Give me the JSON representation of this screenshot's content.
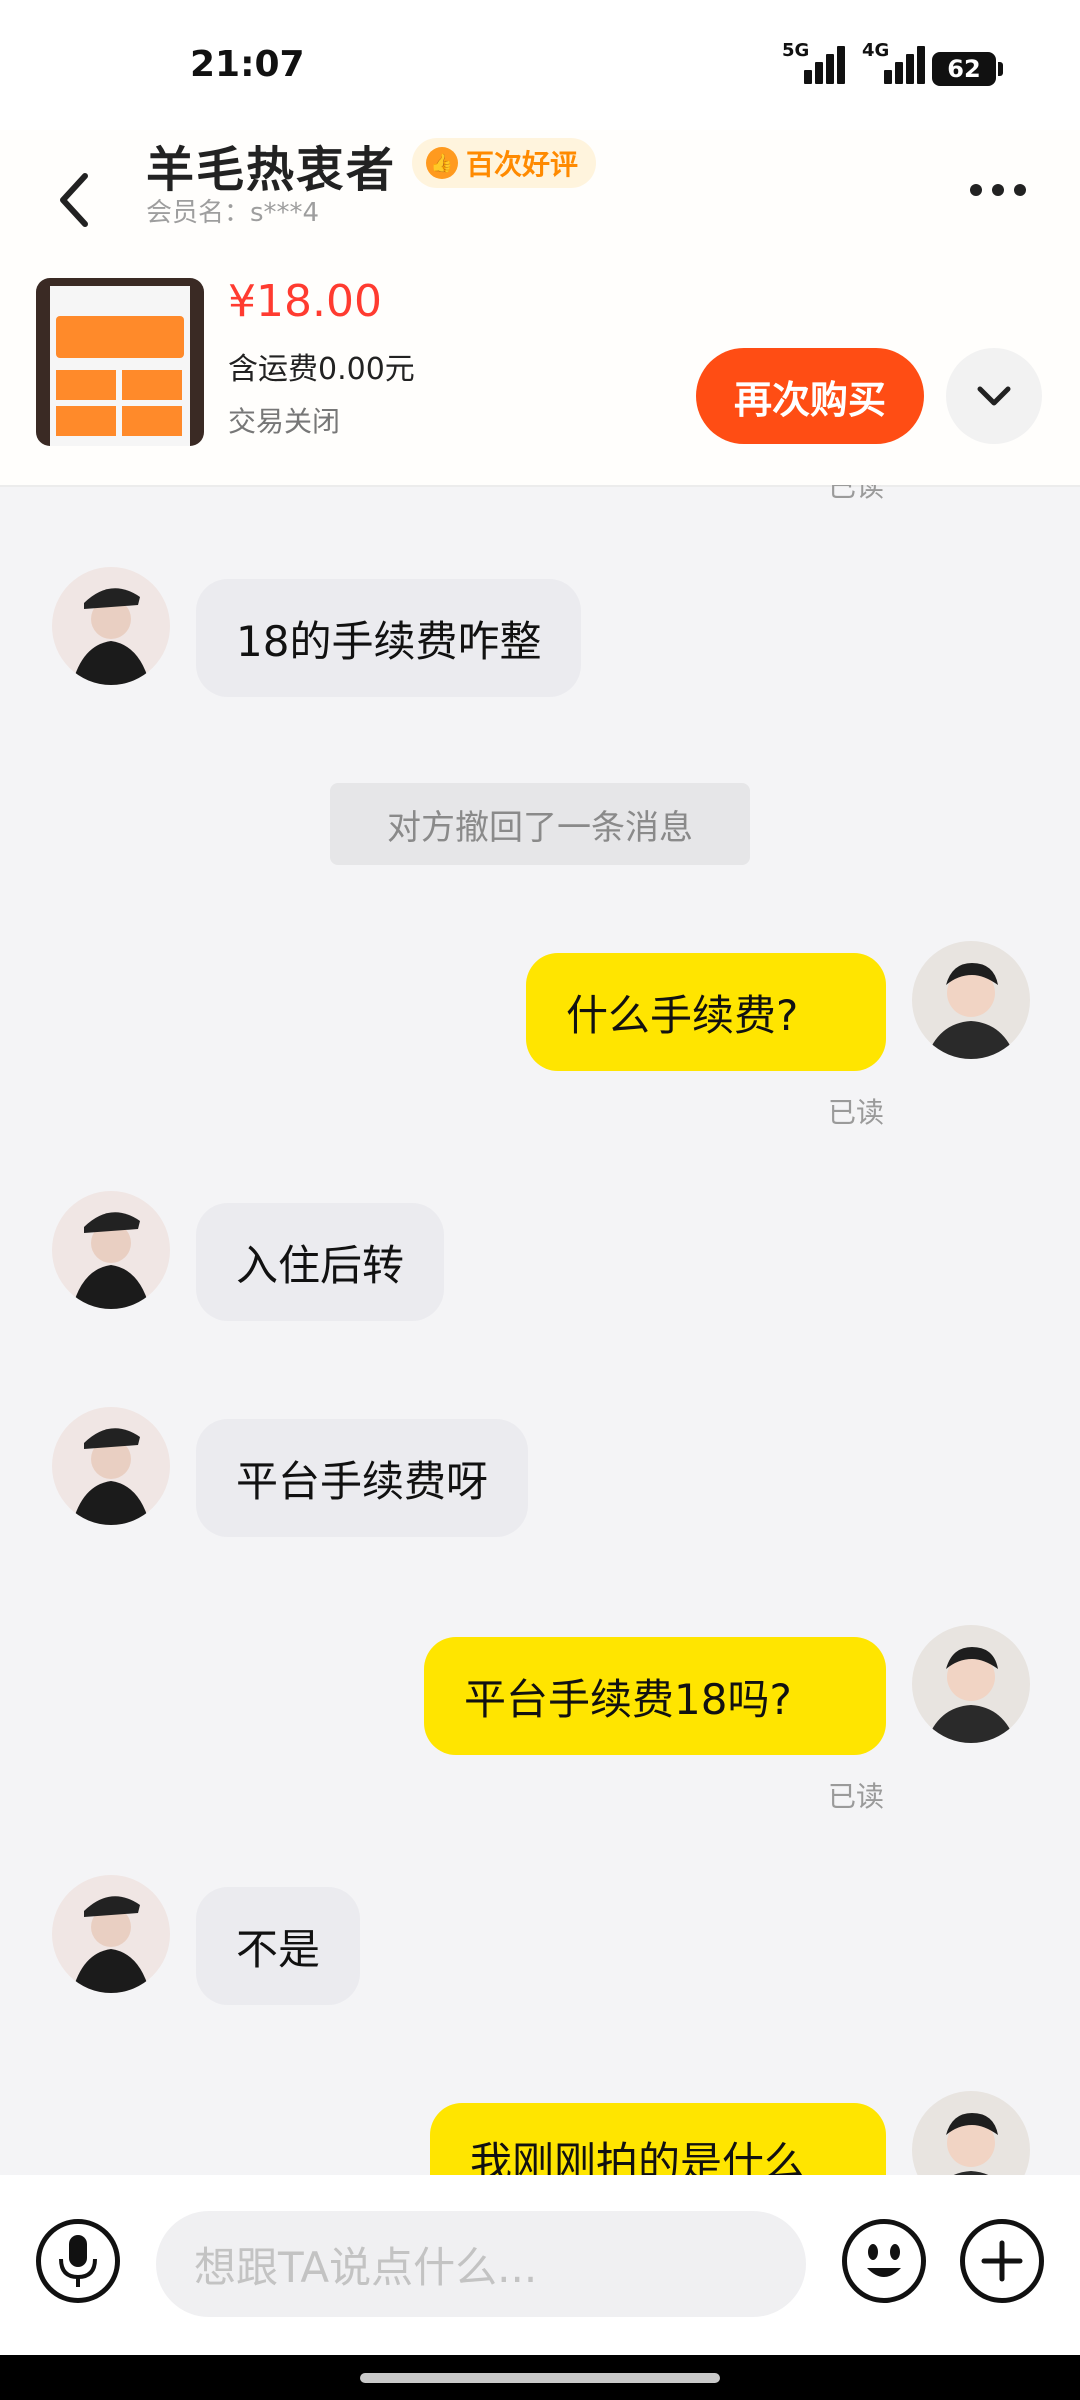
{
  "status_bar": {
    "time": "21:07",
    "network1": "5G",
    "network2": "4G",
    "battery": "62"
  },
  "header": {
    "title": "羊毛热衷者",
    "badge": "百次好评",
    "member": "会员名：s***4",
    "product": {
      "price": "¥18.00",
      "shipping": "含运费0.00元",
      "status": "交易关闭"
    },
    "buy_again": "再次购买"
  },
  "messages": {
    "top_read": "已读",
    "m1": "18的手续费咋整",
    "recall": "对方撤回了一条消息",
    "m2": "什么手续费?",
    "m2_read": "已读",
    "m3": "入住后转",
    "m4": "平台手续费呀",
    "m5": "平台手续费18吗?",
    "m5_read": "已读",
    "m6": "不是",
    "m7": "我刚刚拍的是什么"
  },
  "input": {
    "placeholder": "想跟TA说点什么..."
  },
  "colors": {
    "accent": "#ff4d14",
    "price": "#ff3b30",
    "out_bubble": "#ffe500",
    "in_bubble": "#ebebef"
  }
}
